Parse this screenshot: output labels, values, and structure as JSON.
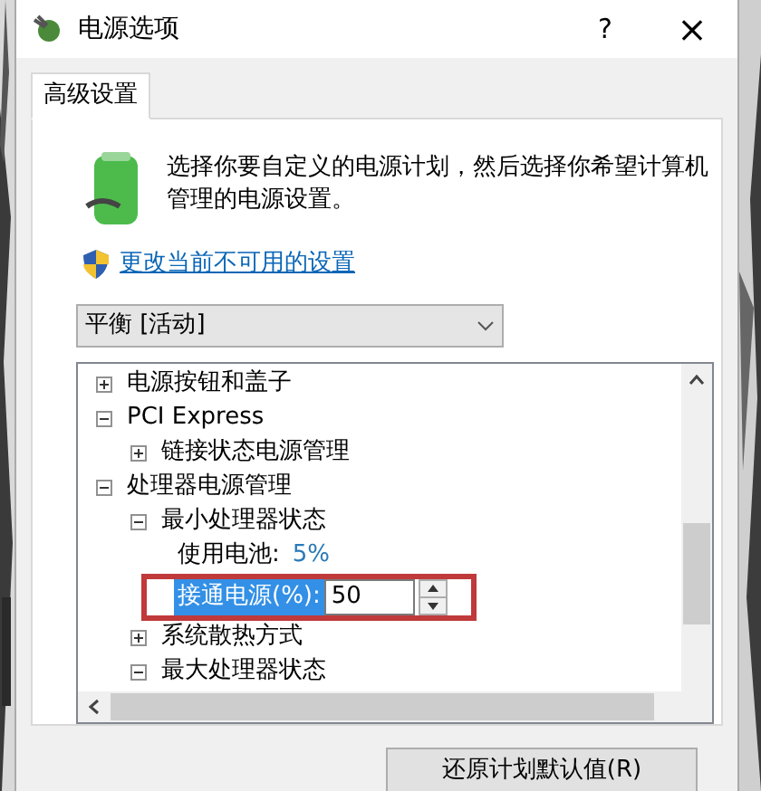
{
  "window": {
    "title": "电源选项",
    "help": "?",
    "close": "×"
  },
  "tabs": [
    {
      "label": "高级设置",
      "selected": true
    }
  ],
  "description": "选择你要自定义的电源计划，然后选择你希望计算机管理的电源设置。",
  "admin_link": "更改当前不可用的设置",
  "plan_dropdown": {
    "value": "平衡 [活动]"
  },
  "settings_tree": [
    {
      "label": "电源按钮和盖子",
      "expanded": false
    },
    {
      "label": "PCI Express",
      "expanded": true,
      "children": [
        {
          "label": "链接状态电源管理",
          "expanded": false
        }
      ]
    },
    {
      "label": "处理器电源管理",
      "expanded": true,
      "children": [
        {
          "label": "最小处理器状态",
          "expanded": true,
          "children": [
            {
              "kind": "value",
              "label": "使用电池:",
              "value": "5%",
              "selected": false
            },
            {
              "kind": "spinner",
              "label": "接通电源(%):",
              "value": "50",
              "selected": true,
              "highlighted": true
            }
          ]
        },
        {
          "label": "系统散热方式",
          "expanded": false
        },
        {
          "label": "最大处理器状态",
          "expanded": true
        }
      ]
    }
  ],
  "buttons": [
    {
      "label": "还原计划默认值(R)"
    }
  ]
}
